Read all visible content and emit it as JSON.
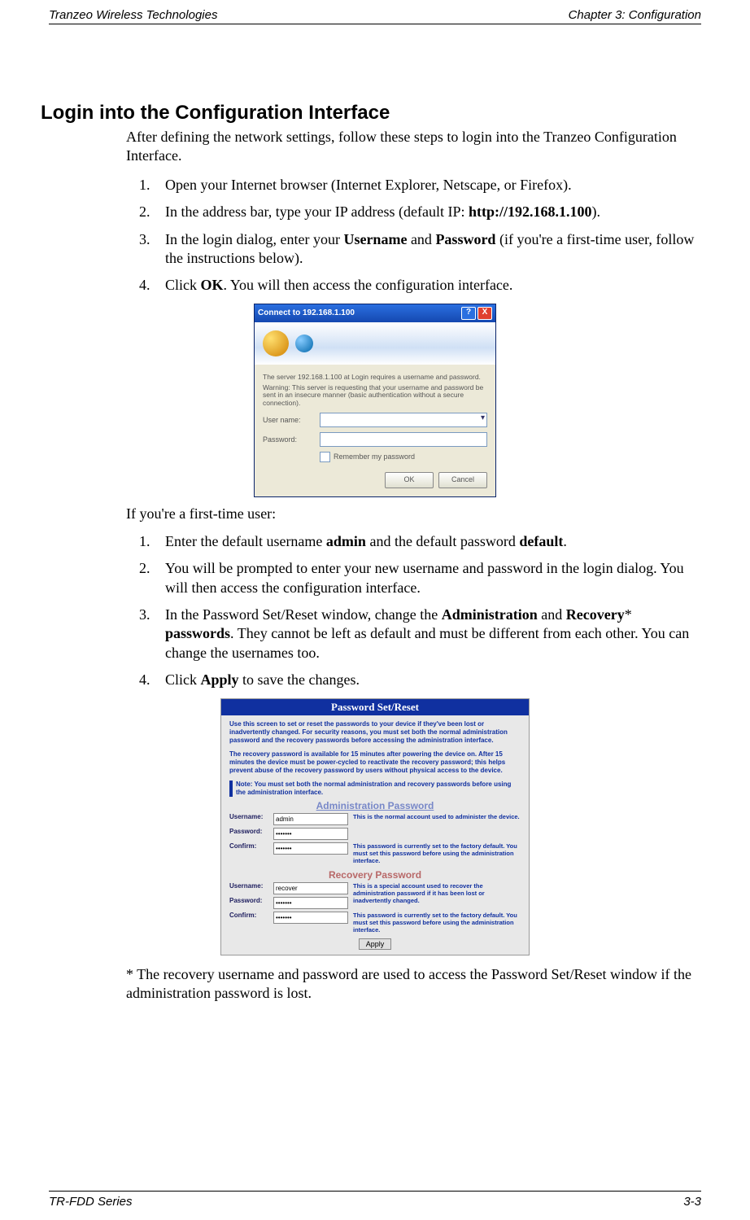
{
  "header": {
    "left": "Tranzeo Wireless Technologies",
    "right": "Chapter 3: Configuration"
  },
  "footer": {
    "left": "TR-FDD Series",
    "right": "3-3"
  },
  "section_title": "Login into the Configuration Interface",
  "intro": "After defining the network settings, follow these steps to login into the Tranzeo Configuration Interface.",
  "steps_a": {
    "s1": "Open your Internet browser (Internet Explorer, Netscape, or Firefox).",
    "s2_pre": "In the address bar, type your IP address (default IP: ",
    "s2_bold": "http://192.168.1.100",
    "s2_post": ").",
    "s3_pre": "In the login dialog, enter your ",
    "s3_b1": "Username",
    "s3_mid": " and ",
    "s3_b2": "Password",
    "s3_post": " (if you're a first-time user, follow the instructions below).",
    "s4_pre": "Click ",
    "s4_bold": "OK",
    "s4_post": ". You will then access the configuration interface."
  },
  "first_user": "If you're a first-time user:",
  "steps_b": {
    "s1_pre": "Enter the default username ",
    "s1_b1": "admin",
    "s1_mid": " and the default password ",
    "s1_b2": "default",
    "s1_post": ".",
    "s2": "You will be prompted to enter your new username and password in the login dialog. You will then access the configuration interface.",
    "s3_pre": "In the Password Set/Reset window, change the ",
    "s3_b1": "Administration",
    "s3_mid": " and ",
    "s3_b2": "Recovery",
    "s3_ast": "* ",
    "s3_b3": "passwords",
    "s3_post": ". They cannot be left as default and must be different from each other. You can change the usernames too.",
    "s4_pre": "Click ",
    "s4_bold": "Apply",
    "s4_post": " to save the changes."
  },
  "footnote": "* The recovery username and password are used to access the Password Set/Reset window if the administration password is lost.",
  "login_dialog": {
    "title": "Connect to 192.168.1.100",
    "help": "?",
    "close": "X",
    "msg1": "The server 192.168.1.100 at Login requires a username and password.",
    "msg2": "Warning: This server is requesting that your username and password be sent in an insecure manner (basic authentication without a secure connection).",
    "username_label": "User name:",
    "password_label": "Password:",
    "remember": "Remember my password",
    "ok": "OK",
    "cancel": "Cancel"
  },
  "pwreset": {
    "title": "Password Set/Reset",
    "p1": "Use this screen to set or reset the passwords to your device if they've been lost or inadvertently changed. For security reasons, you must set both the normal administration password and the recovery passwords before accessing the administration interface.",
    "p2": "The recovery password is available for 15 minutes after powering the device on. After 15 minutes the device must be power-cycled to reactivate the recovery password; this helps prevent abuse of the recovery password by users without physical access to the device.",
    "note": "Note: You must set both the normal administration and recovery passwords before using the administration interface.",
    "admin_head": "Administration Password",
    "rec_head": "Recovery Password",
    "lbl_user": "Username:",
    "lbl_pass": "Password:",
    "lbl_conf": "Confirm:",
    "admin_user": "admin",
    "rec_user": "recover",
    "dots": "•••••••",
    "admin_r1": "This is the normal account used to administer the device.",
    "admin_r2": "This password is currently set to the factory default. You must set this password before using the administration interface.",
    "rec_r1": "This is a special account used to recover the administration password if it has been lost or inadvertently changed.",
    "rec_r2": "This password is currently set to the factory default. You must set this password before using the administration interface.",
    "apply": "Apply"
  }
}
